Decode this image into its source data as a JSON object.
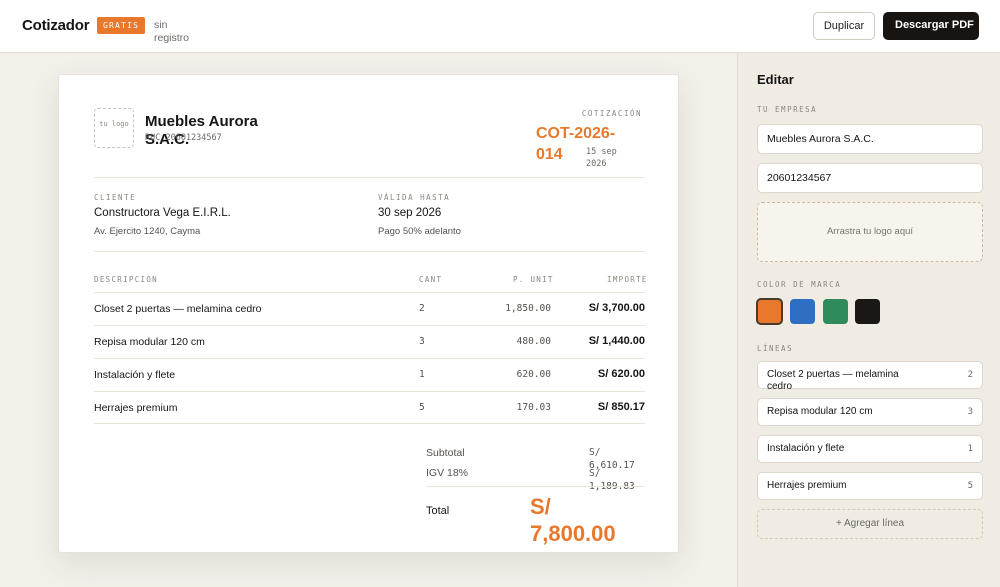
{
  "header": {
    "brand": "Cotizador",
    "badge": "GRATIS",
    "subtitle": "sin registro",
    "duplicate_label": "Duplicar",
    "download_label": "Descargar PDF"
  },
  "document": {
    "logo_placeholder": "tu logo",
    "company_name": "Muebles Aurora S.A.C.",
    "company_ruc": "RUC 20601234567",
    "quote_label": "COTIZACIÓN",
    "quote_number": "COT-2026-014",
    "quote_date": "15 sep 2026",
    "client_label": "CLIENTE",
    "client_name": "Constructora Vega E.I.R.L.",
    "client_address": "Av. Ejercito 1240, Cayma",
    "valid_label": "VÁLIDA HASTA",
    "valid_date": "30 sep 2026",
    "payment_terms": "Pago 50% adelanto",
    "columns": {
      "description": "DESCRIPCIÓN",
      "qty": "CANT",
      "unit": "P. UNIT",
      "amount": "IMPORTE"
    },
    "items": [
      {
        "description": "Closet 2 puertas — melamina cedro",
        "qty": "2",
        "unit_price": "1,850.00",
        "amount": "S/ 3,700.00"
      },
      {
        "description": "Repisa modular 120 cm",
        "qty": "3",
        "unit_price": "480.00",
        "amount": "S/ 1,440.00"
      },
      {
        "description": "Instalación y flete",
        "qty": "1",
        "unit_price": "620.00",
        "amount": "S/ 620.00"
      },
      {
        "description": "Herrajes premium",
        "qty": "5",
        "unit_price": "170.03",
        "amount": "S/ 850.17"
      }
    ],
    "subtotal_label": "Subtotal",
    "subtotal_value": "S/ 6,610.17",
    "tax_label": "IGV 18%",
    "tax_value": "S/ 1,189.83",
    "total_label": "Total",
    "total_value": "S/ 7,800.00",
    "accent_color": "#e8792c"
  },
  "editor": {
    "title": "Editar",
    "company_section": "TU EMPRESA",
    "company_name_value": "Muebles Aurora S.A.C.",
    "ruc_value": "20601234567",
    "logo_drop": "Arrastra tu logo aquí",
    "brand_color_label": "COLOR DE MARCA",
    "colors": [
      "#e8792c",
      "#2f6fc3",
      "#2f8a5c",
      "#1a1714"
    ],
    "selected_color": "#e8792c",
    "lines_label": "LÍNEAS",
    "lines": [
      {
        "name": "Closet 2 puertas — melamina cedro",
        "qty": "2"
      },
      {
        "name": "Repisa modular 120 cm",
        "qty": "3"
      },
      {
        "name": "Instalación y flete",
        "qty": "1"
      },
      {
        "name": "Herrajes premium",
        "qty": "5"
      }
    ],
    "add_line_label": "+ Agregar línea"
  }
}
